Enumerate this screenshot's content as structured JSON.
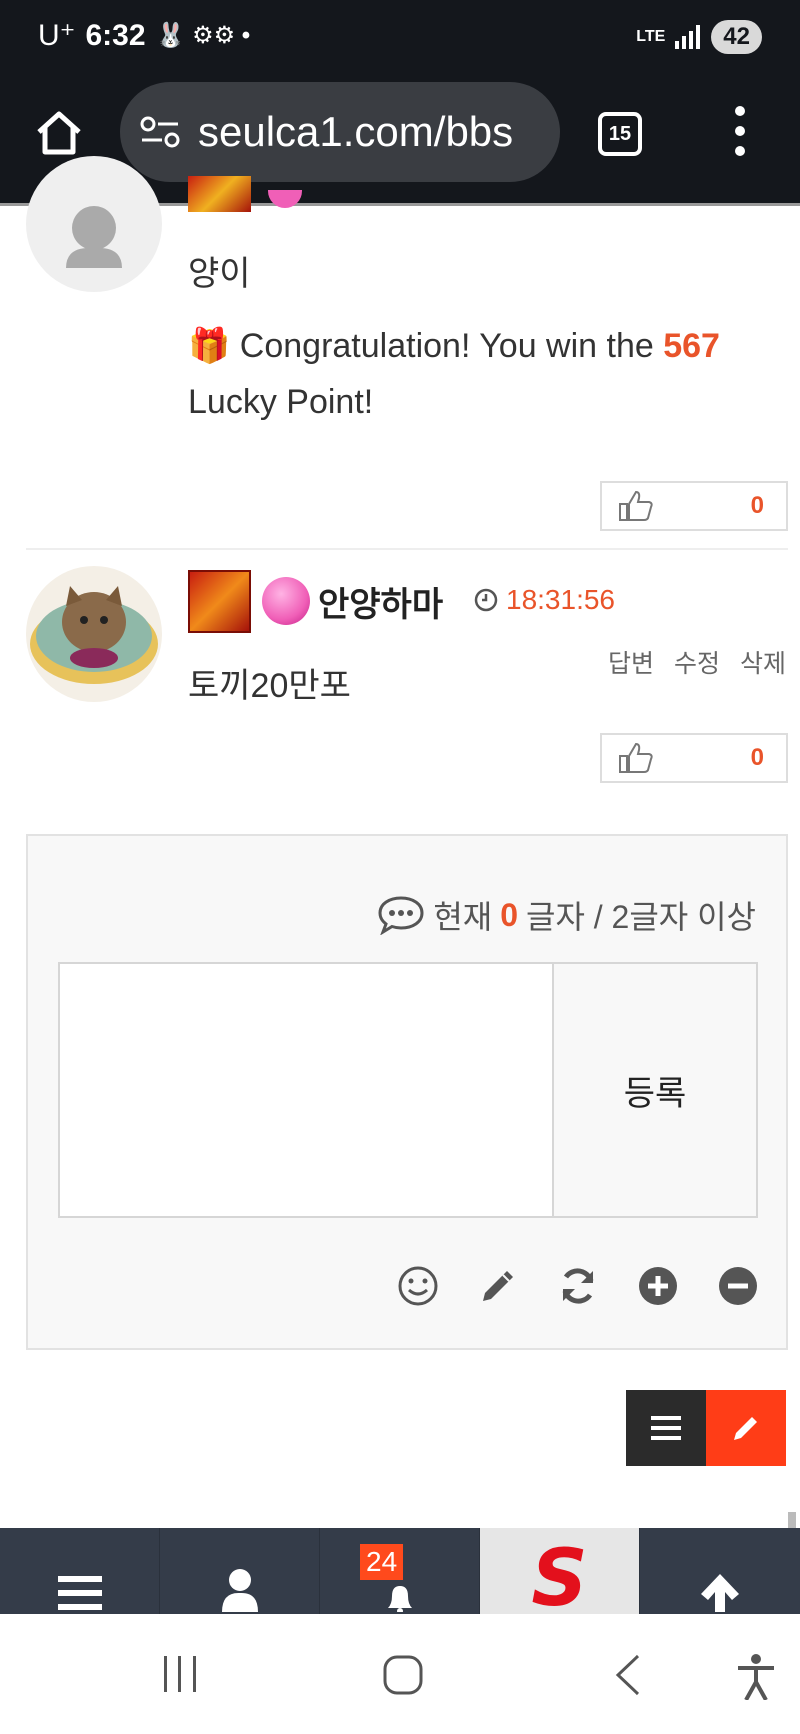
{
  "status_bar": {
    "carrier": "U⁺",
    "time": "6:32",
    "icons_text": "🐰 ⚙⚙ •",
    "network": "LTE",
    "battery": "42"
  },
  "browser": {
    "url": "seulca1.com/bbs",
    "tab_count": "15"
  },
  "comments": [
    {
      "text": "양이",
      "lucky_prefix": "Congratulation! You win the ",
      "lucky_points": "567",
      "lucky_suffix": " Lucky Point!",
      "likes": "0"
    },
    {
      "nickname": "안양하마",
      "time": "18:31:56",
      "text": "토끼20만포",
      "actions": [
        "답변",
        "수정",
        "삭제"
      ],
      "likes": "0"
    }
  ],
  "write_box": {
    "counter_prefix": "현재 ",
    "counter_value": "0",
    "counter_suffix": "글자 / 2글자 이상",
    "submit_label": "등록",
    "textarea_value": ""
  },
  "bottom_nav": {
    "notification_count": "24",
    "logo_letter": "S"
  },
  "colors": {
    "accent": "#e9542a",
    "write_button": "#ff3d17",
    "nav_bg": "#343c49"
  }
}
